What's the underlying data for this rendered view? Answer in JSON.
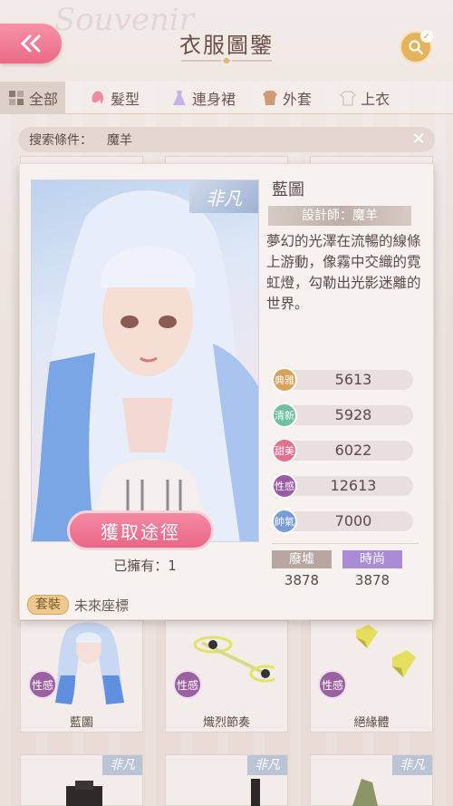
{
  "header": {
    "title": "衣服圖鑒",
    "bg_text": "Souvenir"
  },
  "tabs": [
    {
      "label": "全部",
      "icon": "grid-icon"
    },
    {
      "label": "髮型",
      "icon": "hair-icon"
    },
    {
      "label": "連身裙",
      "icon": "dress-icon"
    },
    {
      "label": "外套",
      "icon": "coat-icon"
    },
    {
      "label": "上衣",
      "icon": "shirt-icon"
    }
  ],
  "filter": {
    "label": "搜索條件：",
    "value": "魔羊"
  },
  "detail": {
    "rarity": "非凡",
    "item_name": "藍圖",
    "designer": "設計師：魔羊",
    "description": "夢幻的光澤在流暢的線條上游動，像霧中交織的霓虹燈，勾勒出光影迷離的世界。",
    "get_button": "獲取途徑",
    "owned": "已擁有：1",
    "suit_tag": "套裝",
    "suit_name": "未來座標",
    "stats": [
      {
        "label": "典雅",
        "value": "5613",
        "color": "#d9a15a"
      },
      {
        "label": "清新",
        "value": "5928",
        "color": "#6fc0a0"
      },
      {
        "label": "甜美",
        "value": "6022",
        "color": "#e56f8e"
      },
      {
        "label": "性感",
        "value": "12613",
        "color": "#9a5aa6"
      },
      {
        "label": "帥氣",
        "value": "7000",
        "color": "#7b9bd8"
      }
    ],
    "tags": [
      {
        "label": "廢墟",
        "value": "3878",
        "color": "#b8a6a0"
      },
      {
        "label": "時尚",
        "value": "3878",
        "color": "#a98bd6"
      }
    ]
  },
  "grid": [
    {
      "name": "藍圖",
      "badge": "性感"
    },
    {
      "name": "熾烈節奏",
      "badge": "性感"
    },
    {
      "name": "絕緣體",
      "badge": "性感"
    }
  ],
  "bottom_row": [
    {
      "rarity": "非凡"
    },
    {
      "rarity": "非凡"
    },
    {
      "rarity": "非凡"
    }
  ]
}
